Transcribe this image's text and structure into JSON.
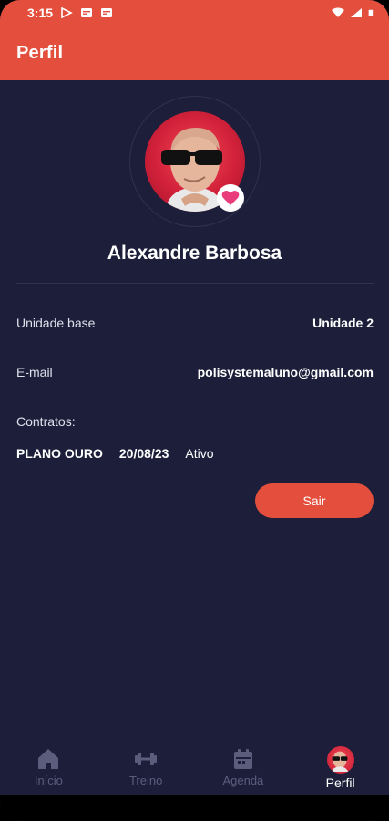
{
  "status_bar": {
    "time": "3:15"
  },
  "app_bar": {
    "title": "Perfil"
  },
  "profile": {
    "name": "Alexandre Barbosa"
  },
  "details": {
    "unit_label": "Unidade base",
    "unit_value": "Unidade 2",
    "email_label": "E-mail",
    "email_value": "polisystemaluno@gmail.com",
    "contracts_label": "Contratos:"
  },
  "contracts": [
    {
      "plan": "PLANO OURO",
      "date": "20/08/23",
      "status": "Ativo"
    }
  ],
  "actions": {
    "logout_label": "Sair"
  },
  "bottom_nav": [
    {
      "label": "Início",
      "icon": "home-icon",
      "active": false
    },
    {
      "label": "Treino",
      "icon": "dumbbell-icon",
      "active": false
    },
    {
      "label": "Agenda",
      "icon": "calendar-icon",
      "active": false
    },
    {
      "label": "Perfil",
      "icon": "avatar",
      "active": true
    }
  ],
  "colors": {
    "accent": "#e44f3d",
    "background": "#1d1f3a",
    "nav_inactive": "#5a5e7c",
    "heart": "#e83d7a"
  }
}
